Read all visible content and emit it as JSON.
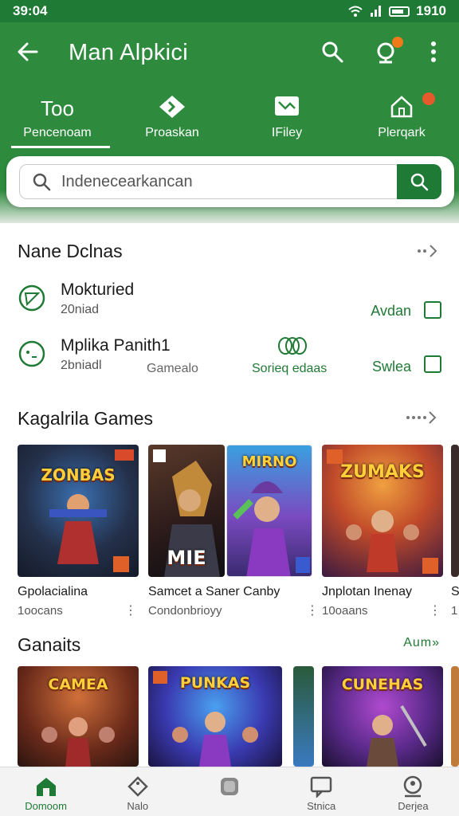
{
  "status": {
    "time": "39:04",
    "battery": "1910"
  },
  "appbar": {
    "title": "Man Alpkici"
  },
  "tabs": [
    {
      "label": "Pencenoam",
      "icon_text": "Too",
      "icon": "text-icon"
    },
    {
      "label": "Proaskan",
      "icon": "diamond-arrow-icon"
    },
    {
      "label": "IFiley",
      "icon": "image-icon"
    },
    {
      "label": "Plerqark",
      "icon": "home-icon"
    }
  ],
  "search": {
    "value": "Indenecearkancan"
  },
  "section1": {
    "title": "Nane Dclnas",
    "rows": [
      {
        "title": "Mokturied",
        "sub": "20niad",
        "mid": "",
        "action": "Avdan"
      },
      {
        "title": "Mplika Panith1",
        "sub": "2bniadl",
        "mid": "Gamealo",
        "extra": "Sorieq edaas",
        "action": "Swlea"
      }
    ]
  },
  "section2": {
    "title": "Kagalrila Games",
    "cards": [
      {
        "title": "Gpolacialina",
        "sub": "1oocans",
        "art": "ZONBAS"
      },
      {
        "title": "Samcet a Saner Canby",
        "sub": "Condonbrioyy",
        "art": "MIE"
      },
      {
        "title": "",
        "sub": "",
        "art": "MIRNO"
      },
      {
        "title": "Jnplotan Inenay",
        "sub": "10oaans",
        "art": "ZUMAKS"
      },
      {
        "title": "S",
        "sub": "1",
        "art": ""
      }
    ]
  },
  "section3": {
    "title": "Ganaits",
    "more": "Aum»",
    "cards": [
      {
        "art": "CAMEA"
      },
      {
        "art": "PUNKAS"
      },
      {
        "art": ""
      },
      {
        "art": "CUNEHAS"
      }
    ]
  },
  "bottomnav": [
    {
      "label": "Domoom"
    },
    {
      "label": "Nalo"
    },
    {
      "label": ""
    },
    {
      "label": "Stnica"
    },
    {
      "label": "Derjea"
    }
  ],
  "colors": {
    "primary": "#2e8b3e",
    "dark": "#1f7a35",
    "badge": "#e55a2a"
  }
}
